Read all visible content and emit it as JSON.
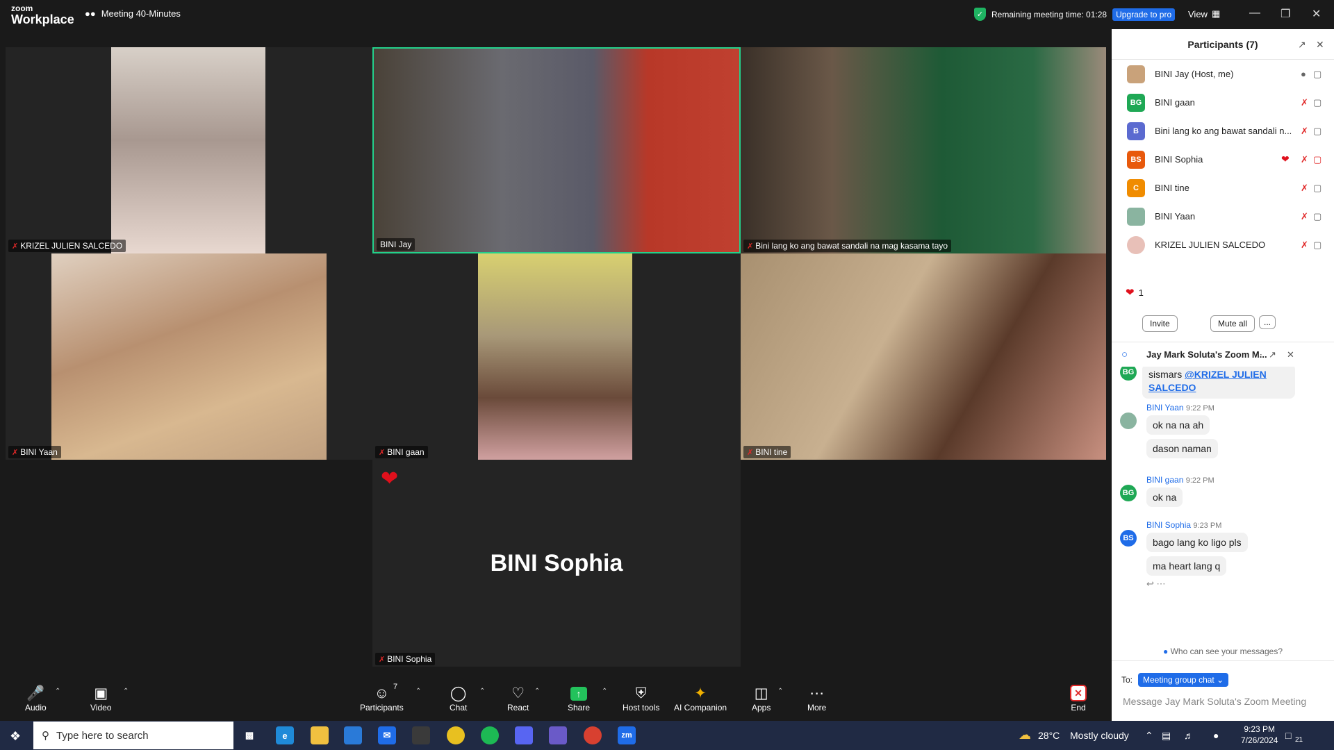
{
  "app": {
    "logo_top": "zoom",
    "logo_bottom": "Workplace",
    "meeting_title": "Meeting 40-Minutes",
    "remaining_text": "Remaining meeting time: 01:28",
    "upgrade_label": "Upgrade to pro",
    "view_label": "View"
  },
  "tiles": [
    {
      "name": "KRIZEL JULIEN SALCEDO"
    },
    {
      "name": "BINI Jay"
    },
    {
      "name": "Bini lang ko ang bawat sandali na mag kasama tayo"
    },
    {
      "name": "BINI Yaan"
    },
    {
      "name": "BINI gaan"
    },
    {
      "name": "BINI tine"
    },
    {
      "name": "BINI Sophia",
      "big_name": "BINI Sophia"
    }
  ],
  "participants": {
    "title": "Participants (7)",
    "list": [
      {
        "name": "BINI Jay (Host, me)",
        "initials": "",
        "color": "#c9a27a"
      },
      {
        "name": "BINI gaan",
        "initials": "BG",
        "color": "#1fa855"
      },
      {
        "name": "Bini lang ko ang bawat sandali n...",
        "initials": "B",
        "color": "#5b6ad0"
      },
      {
        "name": "BINI Sophia",
        "initials": "BS",
        "color": "#e8590c"
      },
      {
        "name": "BINI tine",
        "initials": "C",
        "color": "#f08c00"
      },
      {
        "name": "BINI Yaan",
        "initials": "",
        "color": "#8ab4a0"
      },
      {
        "name": "KRIZEL JULIEN SALCEDO",
        "initials": "",
        "color": "#e8c0b8"
      }
    ],
    "reaction_count": "1",
    "invite_label": "Invite",
    "mute_all_label": "Mute all",
    "more_label": "..."
  },
  "chat": {
    "title": "Jay Mark Soluta's Zoom M...",
    "first_text": "sismars",
    "first_mention": "@KRIZEL JULIEN SALCEDO",
    "messages": [
      {
        "sender": "BINI Yaan",
        "time": "9:22 PM",
        "lines": [
          "ok na na ah",
          "dason naman"
        ]
      },
      {
        "sender": "BINI gaan",
        "time": "9:22 PM",
        "lines": [
          "ok na"
        ]
      },
      {
        "sender": "BINI Sophia",
        "time": "9:23 PM",
        "lines": [
          "bago lang ko ligo pls",
          "ma heart lang q"
        ]
      }
    ],
    "who_can_see": "Who can see your messages?",
    "to_label": "To:",
    "recipient": "Meeting group chat",
    "placeholder": "Message Jay Mark Soluta's Zoom Meeting"
  },
  "toolbar": {
    "audio": "Audio",
    "video": "Video",
    "participants": "Participants",
    "participants_count": "7",
    "chat": "Chat",
    "react": "React",
    "share": "Share",
    "host_tools": "Host tools",
    "ai_companion": "AI Companion",
    "apps": "Apps",
    "more": "More",
    "end": "End"
  },
  "taskbar": {
    "search_placeholder": "Type here to search",
    "temperature": "28°C",
    "weather": "Mostly cloudy",
    "time": "9:23 PM",
    "date": "7/26/2024",
    "notification_count": "21"
  },
  "colors": {
    "active_border": "#23d18b",
    "accent_blue": "#1f6ce8",
    "muted_red": "#e02828",
    "share_green": "#23c25c"
  }
}
